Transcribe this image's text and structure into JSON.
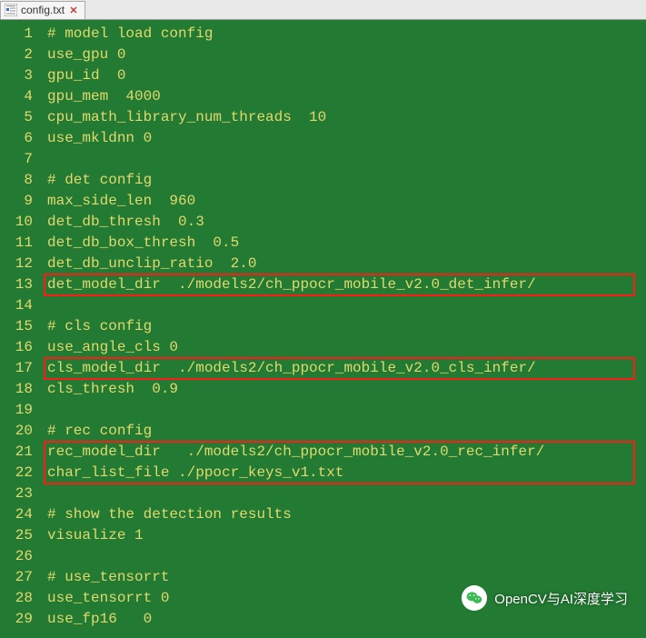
{
  "tab": {
    "title": "config.txt"
  },
  "code": {
    "lines": [
      "# model load config",
      "use_gpu 0",
      "gpu_id  0",
      "gpu_mem  4000",
      "cpu_math_library_num_threads  10",
      "use_mkldnn 0",
      "",
      "# det config",
      "max_side_len  960",
      "det_db_thresh  0.3",
      "det_db_box_thresh  0.5",
      "det_db_unclip_ratio  2.0",
      "det_model_dir  ./models2/ch_ppocr_mobile_v2.0_det_infer/",
      "",
      "# cls config",
      "use_angle_cls 0",
      "cls_model_dir  ./models2/ch_ppocr_mobile_v2.0_cls_infer/",
      "cls_thresh  0.9",
      "",
      "# rec config",
      "rec_model_dir   ./models2/ch_ppocr_mobile_v2.0_rec_infer/",
      "char_list_file ./ppocr_keys_v1.txt",
      "",
      "# show the detection results",
      "visualize 1",
      "",
      "# use_tensorrt",
      "use_tensorrt 0",
      "use_fp16   0"
    ]
  },
  "highlights": [
    {
      "startLine": 13,
      "endLine": 13
    },
    {
      "startLine": 17,
      "endLine": 17
    },
    {
      "startLine": 21,
      "endLine": 22
    }
  ],
  "watermark": {
    "text": "OpenCV与AI深度学习"
  }
}
